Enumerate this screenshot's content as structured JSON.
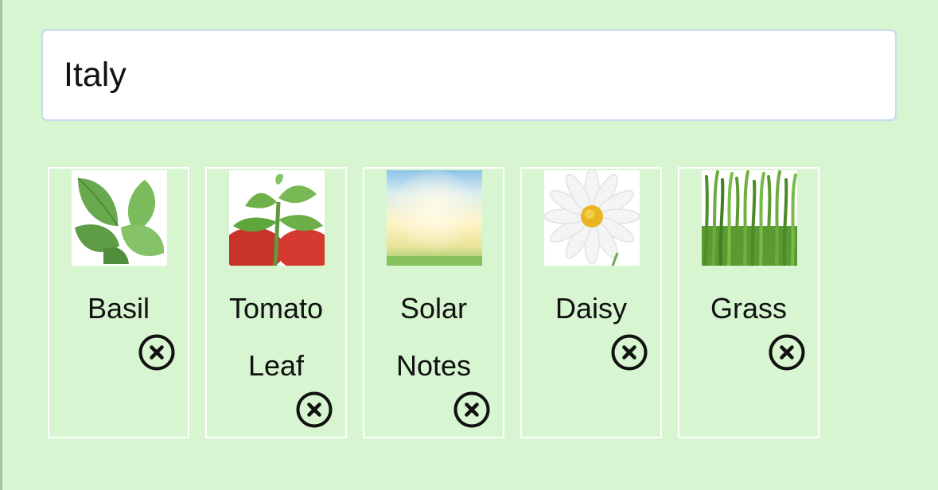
{
  "search": {
    "value": "Italy"
  },
  "tiles": [
    {
      "label_lines": [
        "Basil"
      ],
      "image": "basil-leaves"
    },
    {
      "label_lines": [
        "Tomato",
        "Leaf"
      ],
      "image": "tomato-leaf"
    },
    {
      "label_lines": [
        "Solar",
        "Notes"
      ],
      "image": "sunlit-field"
    },
    {
      "label_lines": [
        "Daisy"
      ],
      "image": "white-daisy"
    },
    {
      "label_lines": [
        "Grass"
      ],
      "image": "green-grass"
    }
  ],
  "icons": {
    "remove": "close-circle-icon"
  },
  "colors": {
    "background": "#d6f5d0",
    "tile_border": "#ffffff",
    "input_border": "#c9daf0"
  }
}
